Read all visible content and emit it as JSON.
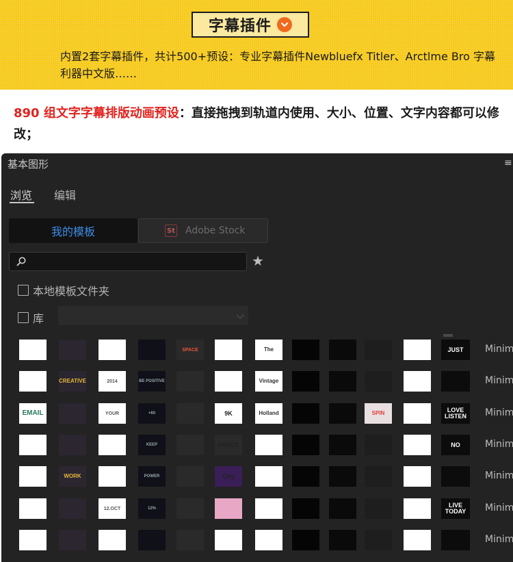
{
  "banner": {
    "title": "字幕插件",
    "description": "内置2套字幕插件，共计500+预设：专业字幕插件Newbluefx Titler、Arctlme Bro 字幕利器中文版……",
    "accent_color": "#f6c919",
    "icon": "chevron-down-circle-icon"
  },
  "headline": {
    "highlight": "890 组文字字幕排版动画预设",
    "text": "：直接拖拽到轨道内使用、大小、位置、文字内容都可以修改；",
    "highlight_color": "#e1231e"
  },
  "panel": {
    "title": "基本图形",
    "menu_icon": "hamburger-menu-icon",
    "tabs": [
      {
        "label": "浏览",
        "active": true
      },
      {
        "label": "编辑",
        "active": false
      }
    ],
    "segments": {
      "mine": "我的模板",
      "stock_badge": "St",
      "stock": "Adobe Stock"
    },
    "search": {
      "value": "",
      "placeholder": ""
    },
    "local_templates_label": "本地模板文件夹",
    "library_label": "库",
    "library_value": "",
    "row_label": "Minim",
    "thumbnails": [
      [
        "",
        "",
        "",
        "",
        "SPACE",
        "",
        "The",
        "",
        "",
        "",
        "",
        "JUST"
      ],
      [
        "",
        "CREATIVE",
        "2014",
        "BE POSITIVE",
        "",
        "",
        "Vintage",
        "",
        "",
        "",
        "",
        ""
      ],
      [
        "EMAIL",
        "",
        "YOUR",
        "+60",
        "",
        "9K",
        "Holland",
        "",
        "",
        "SPIN",
        "",
        "LOVE LISTEN"
      ],
      [
        "",
        "",
        "",
        "KEEP",
        "",
        "FANCY",
        "",
        "",
        "",
        "",
        "",
        "NO"
      ],
      [
        "",
        "WORK",
        "",
        "POWER",
        "",
        "City",
        "",
        "",
        "",
        "",
        "",
        ""
      ],
      [
        "",
        "",
        "12.OCT",
        "12%",
        "",
        "",
        "",
        "",
        "",
        "",
        "",
        "LIVE TODAY"
      ],
      [
        "",
        "",
        "",
        "",
        "",
        "",
        "",
        "",
        "",
        "",
        "",
        ""
      ]
    ]
  }
}
